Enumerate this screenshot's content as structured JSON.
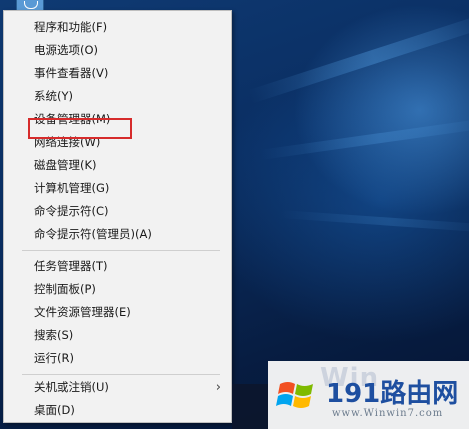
{
  "menu": {
    "items": [
      {
        "label": "程序和功能(F)"
      },
      {
        "label": "电源选项(O)"
      },
      {
        "label": "事件查看器(V)"
      },
      {
        "label": "系统(Y)"
      },
      {
        "label": "设备管理器(M)",
        "highlighted": true
      },
      {
        "label": "网络连接(W)"
      },
      {
        "label": "磁盘管理(K)"
      },
      {
        "label": "计算机管理(G)"
      },
      {
        "label": "命令提示符(C)"
      },
      {
        "label": "命令提示符(管理员)(A)"
      },
      {
        "label": "任务管理器(T)"
      },
      {
        "label": "控制面板(P)"
      },
      {
        "label": "文件资源管理器(E)"
      },
      {
        "label": "搜索(S)"
      },
      {
        "label": "运行(R)"
      },
      {
        "label": "关机或注销(U)",
        "submenu": true
      },
      {
        "label": "桌面(D)"
      }
    ],
    "submenu_glyph": "›",
    "highlight_color": "#d62b2b"
  },
  "watermark": {
    "ghost_text": "Win",
    "main_text": "191路由网",
    "url_text": "www.Winwin7.com"
  },
  "icons": {
    "start": "windows-start-icon",
    "logo": "windows-flag-icon"
  }
}
